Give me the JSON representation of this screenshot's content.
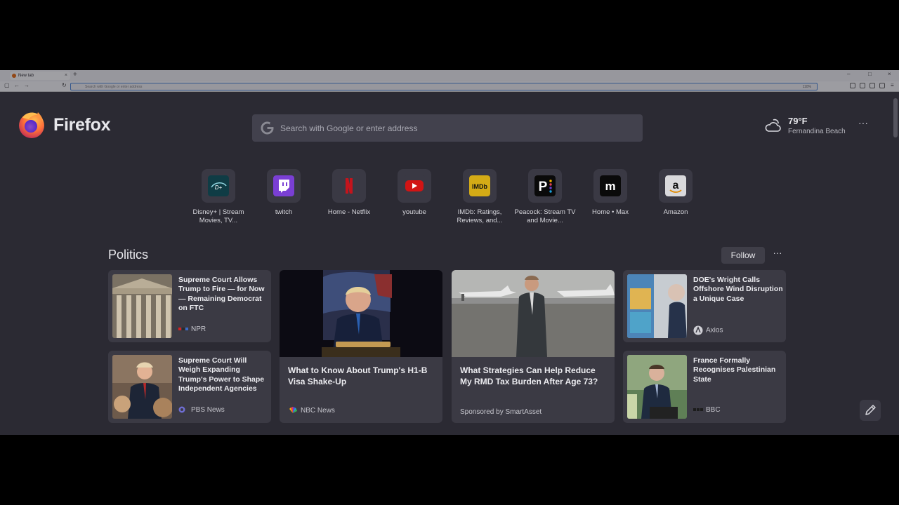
{
  "browser": {
    "tab_title": "New tab",
    "url_placeholder": "Search with Google or enter address",
    "zoom": "110%"
  },
  "logo": {
    "text": "Firefox"
  },
  "search": {
    "placeholder": "Search with Google or enter address"
  },
  "weather": {
    "temp": "79°F",
    "location": "Fernandina Beach"
  },
  "shortcuts": [
    {
      "label": "Disney+ | Stream Movies, TV...",
      "icon": "disney-plus-icon",
      "color": "#0f3c45"
    },
    {
      "label": "twitch",
      "icon": "twitch-icon",
      "color": "#9146ff"
    },
    {
      "label": "Home - Netflix",
      "icon": "netflix-icon",
      "color": "#e50914"
    },
    {
      "label": "youtube",
      "icon": "youtube-icon",
      "color": "#ff0000"
    },
    {
      "label": "IMDb: Ratings, Reviews, and...",
      "icon": "imdb-icon",
      "color": "#f5c518"
    },
    {
      "label": "Peacock: Stream TV and Movie...",
      "icon": "peacock-icon",
      "color": "#000000"
    },
    {
      "label": "Home • Max",
      "icon": "max-icon",
      "color": "#000000"
    },
    {
      "label": "Amazon",
      "icon": "amazon-icon",
      "color": "#ffffff"
    }
  ],
  "section": {
    "title": "Politics",
    "follow_label": "Follow"
  },
  "stories": [
    {
      "title": "Supreme Court Allows Trump to Fire — for Now — Remaining Democrat on FTC",
      "source": "NPR"
    },
    {
      "title": "Supreme Court Will Weigh Expanding Trump's Power to Shape Independent Agencies",
      "source": "PBS News"
    },
    {
      "title": "What to Know About Trump's H1-B Visa Shake-Up",
      "source": "NBC News"
    },
    {
      "title": "What Strategies Can Help Reduce My RMD Tax Burden After Age 73?",
      "source": "Sponsored by SmartAsset"
    },
    {
      "title": "DOE's Wright Calls Offshore Wind Disruption a Unique Case",
      "source": "Axios"
    },
    {
      "title": "France Formally Recognises Palestinian State",
      "source": "BBC"
    }
  ]
}
